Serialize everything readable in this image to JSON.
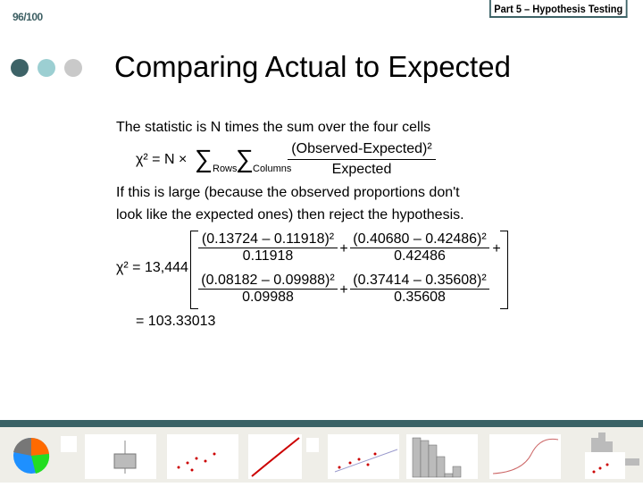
{
  "page_number": "96/100",
  "section": "Part 5 – Hypothesis Testing",
  "title": "Comparing Actual to Expected",
  "dot_colors": [
    "#3d6367",
    "#9ccfd2",
    "#c9c9c9"
  ],
  "body": {
    "line1": "The statistic is N times the sum over the four cells",
    "chi_lhs": "χ² = N ×",
    "sum_rows": "Rows",
    "sum_cols": "Columns",
    "frac_num": "(Observed-Expected)²",
    "frac_den": "Expected",
    "line2": "If this is large (because the observed proportions don't",
    "line3": "look like the expected ones) then reject the hypothesis.",
    "chi_n": "χ² = 13,444",
    "cells": [
      {
        "num": "(0.13724 – 0.11918)²",
        "den": "0.11918"
      },
      {
        "num": "(0.40680 – 0.42486)²",
        "den": "0.42486"
      },
      {
        "num": "(0.08182 – 0.09988)²",
        "den": "0.09988"
      },
      {
        "num": "(0.37414 – 0.35608)²",
        "den": "0.35608"
      }
    ],
    "plus": "+",
    "result": "= 103.33013"
  },
  "thumbnails": [
    "pie-chart",
    "boxplot",
    "scatter-plot",
    "probability-plot",
    "scatter-plot",
    "histogram",
    "cdf-plot",
    "scatter-histogram"
  ],
  "accent": "#3a6266"
}
